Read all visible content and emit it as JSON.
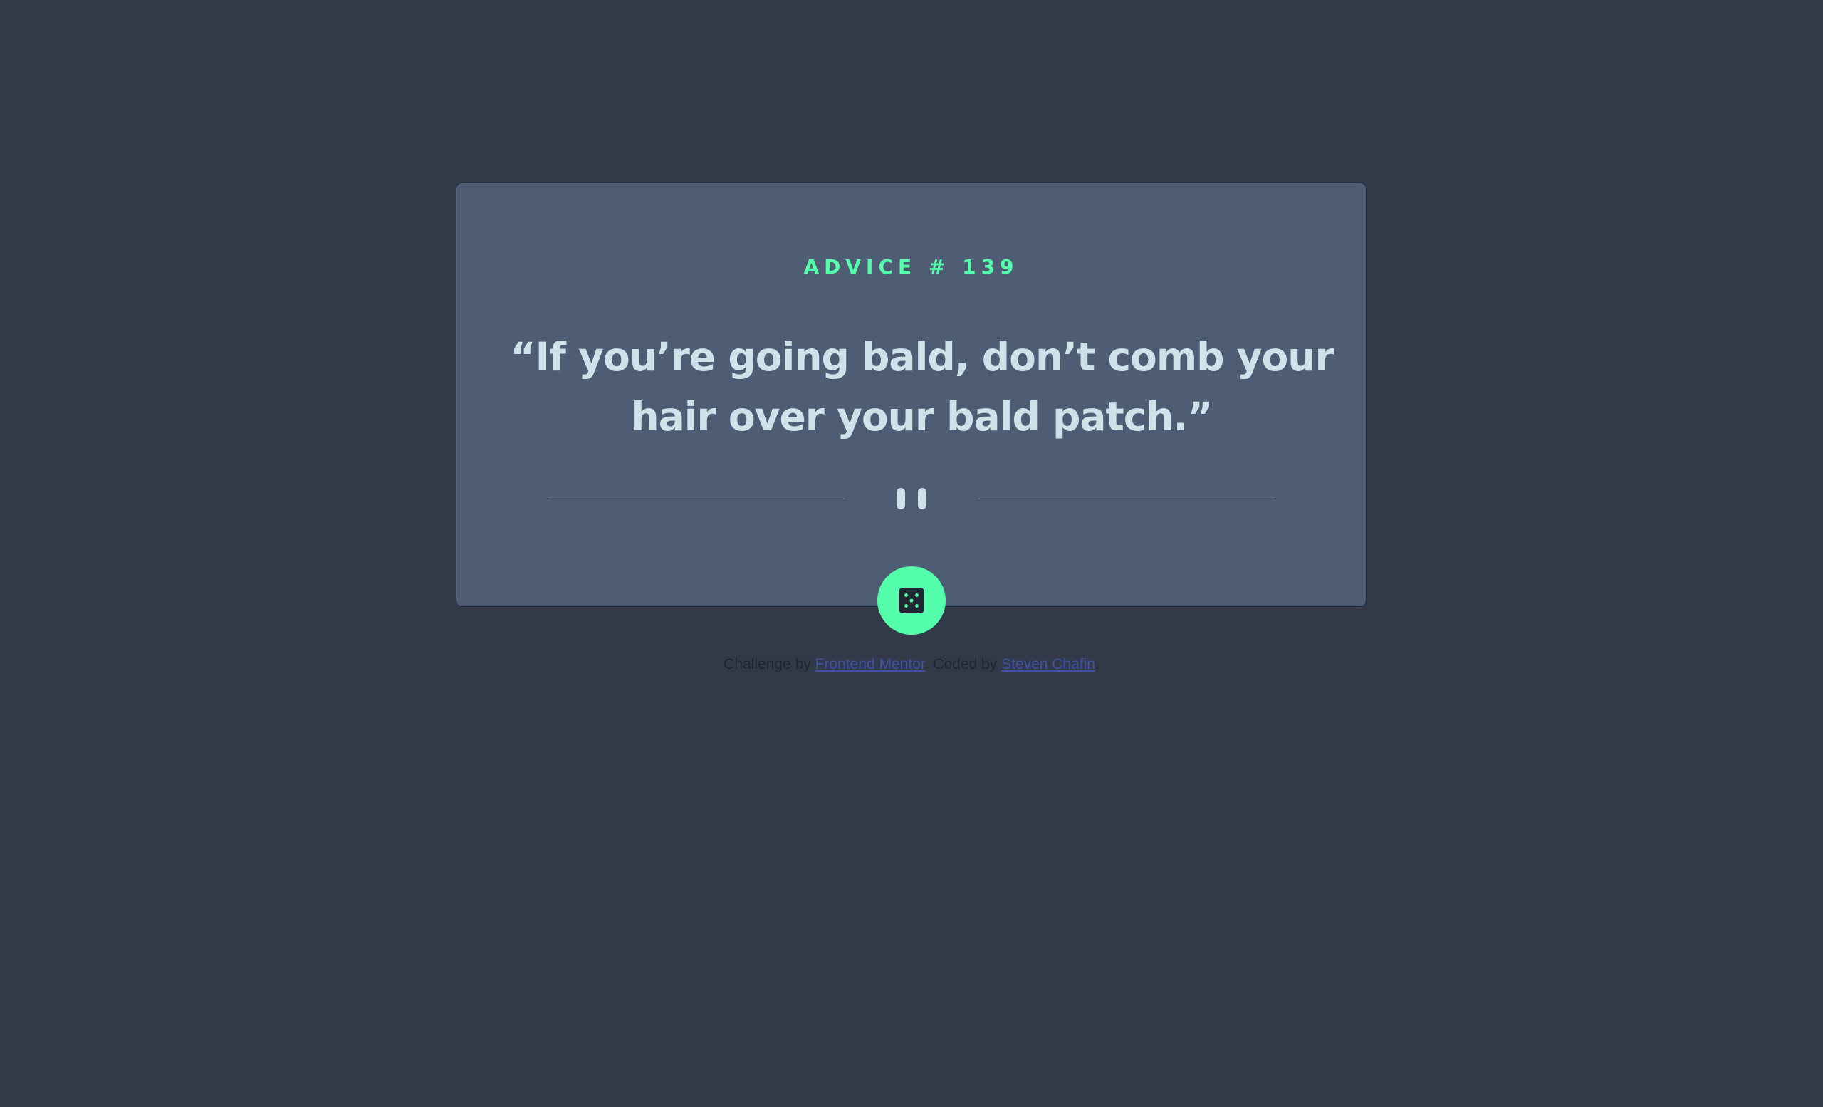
{
  "card": {
    "advice_label": "ADVICE # 139",
    "quote": "“If you’re going bald, don’t comb your hair over your bald patch.”"
  },
  "divider": {
    "icon": "pause-icon"
  },
  "dice_button": {
    "icon": "dice-icon"
  },
  "attribution": {
    "prefix": "Challenge by ",
    "challenge_link": "Frontend Mentor",
    "middle": ". Coded by ",
    "author_link": "Steven Chafin",
    "suffix": "."
  },
  "colors": {
    "background": "#323a49",
    "card": "#4e5d73",
    "accent": "#53ffaa",
    "text": "#cee3e9",
    "link": "#3e52a3"
  }
}
